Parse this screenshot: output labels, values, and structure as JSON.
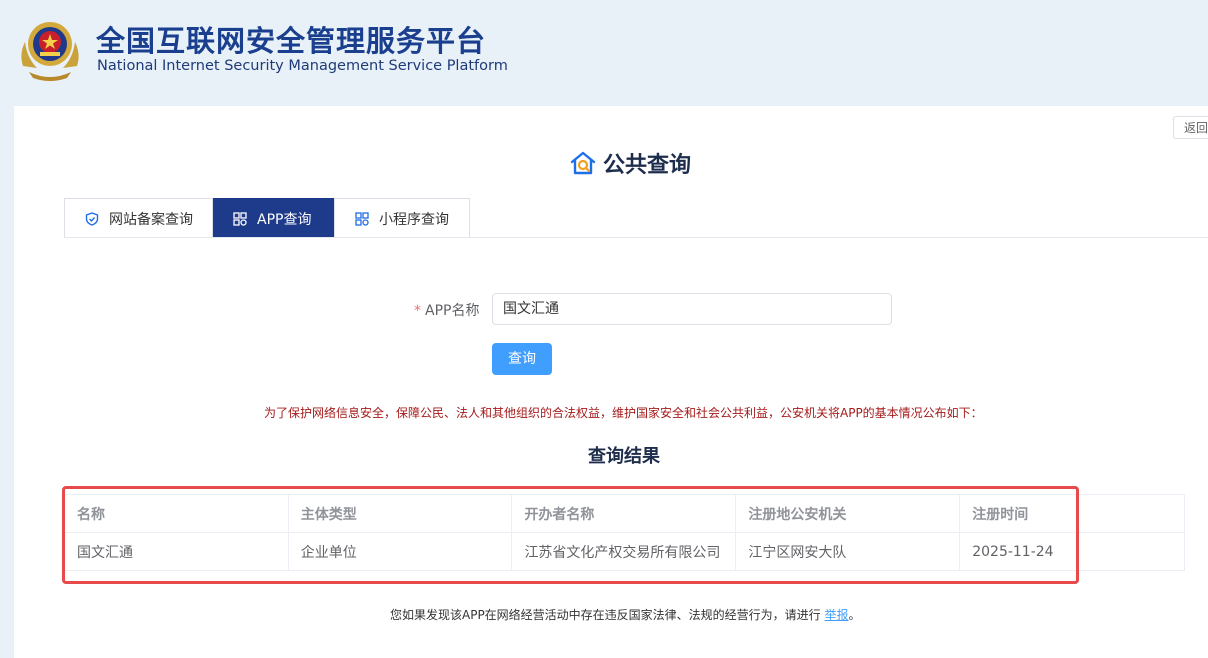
{
  "header": {
    "title_cn": "全国互联网安全管理服务平台",
    "title_en": "National Internet Security Management Service Platform"
  },
  "toolbar": {
    "back_label": "返回"
  },
  "section": {
    "title": "公共查询"
  },
  "tabs": [
    {
      "label": "网站备案查询",
      "icon": "shield-icon",
      "active": false
    },
    {
      "label": "APP查询",
      "icon": "grid-icon",
      "active": true
    },
    {
      "label": "小程序查询",
      "icon": "grid-icon",
      "active": false
    }
  ],
  "form": {
    "required_mark": "*",
    "label": "APP名称",
    "value": "国文汇通",
    "submit_label": "查询"
  },
  "notice": "为了保护网络信息安全，保障公民、法人和其他组织的合法权益，维护国家安全和社会公共利益，公安机关将APP的基本情况公布如下：",
  "results": {
    "title": "查询结果",
    "columns": [
      "名称",
      "主体类型",
      "开办者名称",
      "注册地公安机关",
      "注册时间"
    ],
    "rows": [
      [
        "国文汇通",
        "企业单位",
        "江苏省文化产权交易所有限公司",
        "江宁区网安大队",
        "2025-11-24"
      ]
    ]
  },
  "footer": {
    "text_before": "您如果发现该APP在网络经营活动中存在违反国家法律、法规的经营行为，请进行 ",
    "link_label": "举报",
    "text_after": "。"
  },
  "colors": {
    "brand": "#1e3a8a",
    "accent": "#409eff",
    "notice": "#a61b1b",
    "highlight": "#e8494b"
  }
}
